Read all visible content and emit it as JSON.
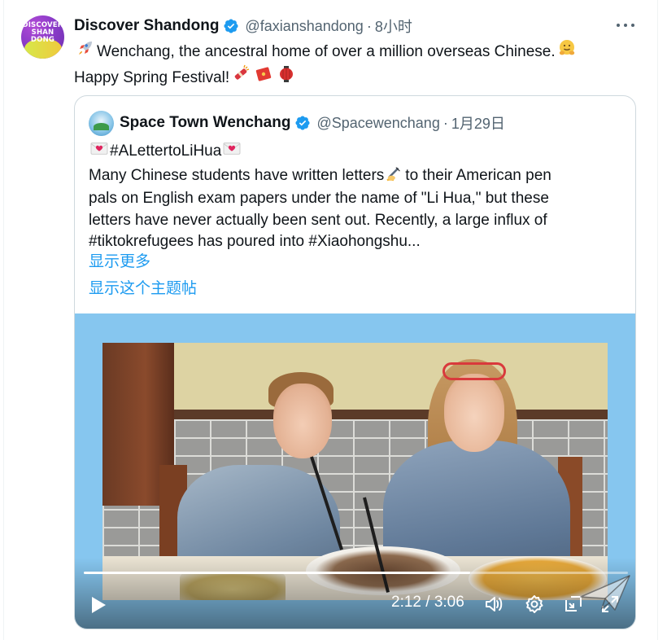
{
  "tweet": {
    "author": {
      "display_name": "Discover Shandong",
      "handle": "@faxianshandong",
      "separator": "·",
      "time": "8小时",
      "avatar_text": [
        "DISCOVER",
        "SHAN",
        "DONG"
      ]
    },
    "text": {
      "line1": "Wenchang, the ancestral home of over a million overseas Chinese.",
      "line2": "Happy Spring Festival!"
    },
    "more_icon": "more-horizontal-icon"
  },
  "quote": {
    "author": {
      "display_name": "Space Town Wenchang",
      "handle": "@Spacewenchang",
      "separator": "·",
      "time": "1月29日"
    },
    "hashtag_line": "#ALettertoLiHua",
    "text_lines": [
      "Many Chinese students have written letters",
      "to their American pen",
      "pals on English exam papers under the name of \"Li Hua,\" but these",
      "letters have never actually been sent out. Recently, a large influx of",
      "#tiktokrefugees has poured into #Xiaohongshu..."
    ],
    "show_more": "显示更多",
    "show_thread": "显示这个主题帖"
  },
  "video": {
    "current_time": "2:12",
    "time_separator": "/",
    "duration": "3:06",
    "progress": 0.71,
    "controls": [
      "play-icon",
      "volume-icon",
      "settings-icon",
      "picture-in-picture-icon",
      "fullscreen-icon"
    ]
  },
  "colors": {
    "link": "#1d9bf0",
    "secondary_text": "#536471",
    "border": "#cfd9de",
    "media_background": "#86c6ef"
  }
}
